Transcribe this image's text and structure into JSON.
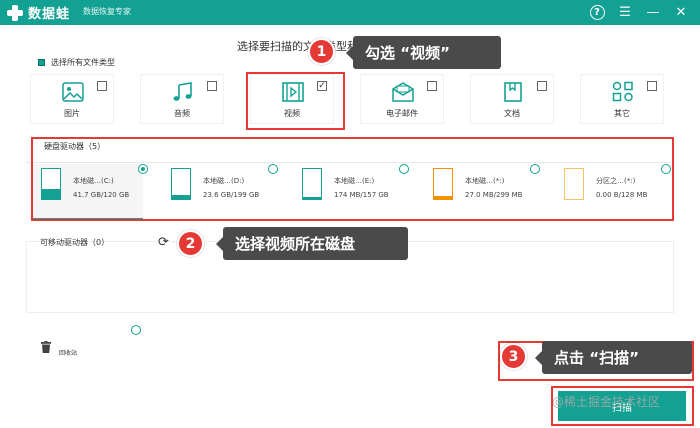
{
  "app": {
    "name": "数据蛙",
    "subtitle": "数据恢复专家"
  },
  "titlebar_icons": [
    "help-icon",
    "menu-icon",
    "minimize-icon",
    "close-icon"
  ],
  "heading": "选择要扫描的文件类型和驱动器",
  "select_all_label": "选择所有文件类型",
  "file_types": [
    {
      "label": "图片",
      "icon": "image-icon",
      "checked": false
    },
    {
      "label": "音频",
      "icon": "music-icon",
      "checked": false
    },
    {
      "label": "视频",
      "icon": "video-icon",
      "checked": true
    },
    {
      "label": "电子邮件",
      "icon": "email-icon",
      "checked": false
    },
    {
      "label": "文档",
      "icon": "document-icon",
      "checked": false
    },
    {
      "label": "其它",
      "icon": "other-icon",
      "checked": false
    }
  ],
  "drives_section_label": "硬盘驱动器（5）",
  "drives": [
    {
      "name": "本地磁…(C:)",
      "size": "41.7 GB/120 GB",
      "used_fraction": 0.35,
      "selected": true,
      "fill_color": "#13a193",
      "border_color": "#13a193"
    },
    {
      "name": "本地磁…(D:)",
      "size": "23.6 GB/199 GB",
      "used_fraction": 0.12,
      "selected": false,
      "fill_color": "#13a193",
      "border_color": "#13a193"
    },
    {
      "name": "本地磁…(E:)",
      "size": "174 MB/157 GB",
      "used_fraction": 0.02,
      "selected": false,
      "fill_color": "#13a193",
      "border_color": "#13a193"
    },
    {
      "name": "本地磁…(*:)",
      "size": "27.0 MB/299 MB",
      "used_fraction": 0.09,
      "selected": false,
      "fill_color": "#f39200",
      "border_color": "#f39200"
    },
    {
      "name": "分区之…(*:)",
      "size": "0.00  B/128 MB",
      "used_fraction": 0.0,
      "selected": false,
      "fill_color": "#f5c26b",
      "border_color": "#f5c26b"
    }
  ],
  "removable_section_label": "可移动驱动器（0）",
  "recycle_label": "回收站",
  "callouts": [
    {
      "number": "1",
      "text": "勾选 “视频”"
    },
    {
      "number": "2",
      "text": "选择视频所在磁盘"
    },
    {
      "number": "3",
      "text": "点击 “扫描”"
    }
  ],
  "scan_button_label": "扫描",
  "watermark": "@稀土掘金技术社区",
  "colors": {
    "accent": "#13a193",
    "highlight_red": "#e53935",
    "callout_bg": "#4a4a4a"
  }
}
